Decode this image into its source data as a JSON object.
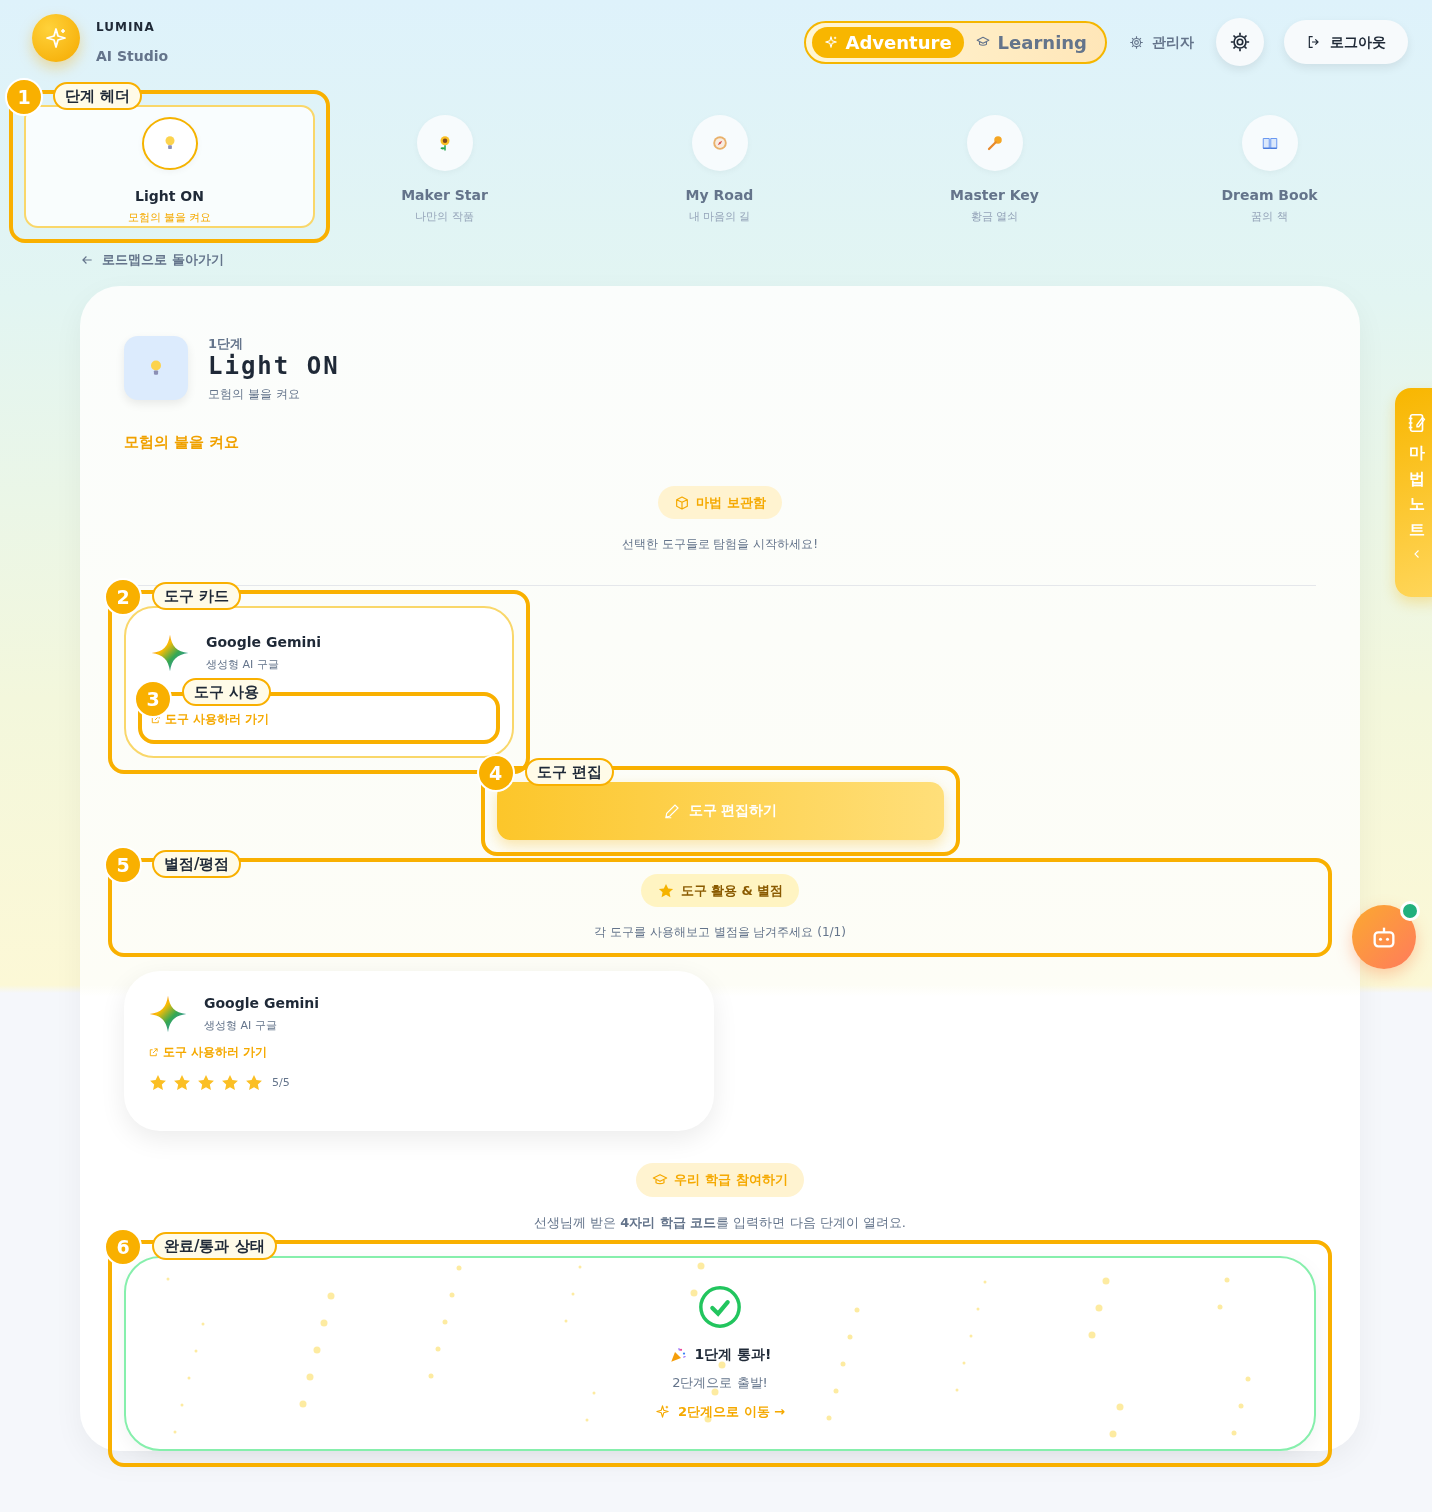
{
  "header": {
    "logo_title": "LUMINA",
    "logo_subtitle": "AI Studio",
    "mode_tabs": [
      {
        "label": "Adventure",
        "selected": true
      },
      {
        "label": "Learning",
        "selected": false
      }
    ],
    "admin_link": "관리자",
    "logout_button": "로그아웃"
  },
  "stages": [
    {
      "title": "Light ON",
      "subtitle": "모험의 불을 켜요",
      "selected": true
    },
    {
      "title": "Maker Star",
      "subtitle": "나만의 작품",
      "selected": false
    },
    {
      "title": "My Road",
      "subtitle": "내 마음의 길",
      "selected": false
    },
    {
      "title": "Master Key",
      "subtitle": "황금 열쇠",
      "selected": false
    },
    {
      "title": "Dream Book",
      "subtitle": "꿈의 책",
      "selected": false
    }
  ],
  "back_link": "로드맵으로 돌아가기",
  "stage_panel": {
    "step": "1단계",
    "title": "Light ON",
    "subtitle": "모험의 불을 켜요",
    "mission": "모험의 불을 켜요"
  },
  "magic_box": {
    "badge": "마법 보관함",
    "hint": "선택한 도구들로 탐험을 시작하세요!"
  },
  "tool_card": {
    "name": "Google Gemini",
    "description": "생성형 AI 구글",
    "link": "도구 사용하러 가기"
  },
  "edit_button": "도구 편집하기",
  "rating": {
    "badge": "도구 활용 & 별점",
    "hint": "각 도구를 사용해보고 별점을 남겨주세요 (1/1)",
    "tools": [
      {
        "name": "Google Gemini",
        "description": "생성형 AI 구글",
        "link": "도구 사용하러 가기",
        "stars": 5,
        "score": "5/5"
      }
    ]
  },
  "class_join": {
    "badge": "우리 학급 참여하기",
    "hint": "선생님께 받은 **4자리 학급 코드**를 입력하면 다음 단계이 열려요."
  },
  "completion": {
    "passed": true,
    "title": "1단계 통과!",
    "subtitle": "2단계으로 출발!",
    "link": "2단계으로 이동 →"
  },
  "side_tab": {
    "label": "마법노트"
  },
  "chatbot": {
    "online": true
  },
  "annotations": [
    {
      "number": "1",
      "label": "단계 헤더"
    },
    {
      "number": "2",
      "label": "도구 카드"
    },
    {
      "number": "3",
      "label": "도구 사용"
    },
    {
      "number": "4",
      "label": "도구 편집"
    },
    {
      "number": "5",
      "label": "별점/평점"
    },
    {
      "number": "6",
      "label": "완료/통과 상태"
    }
  ]
}
